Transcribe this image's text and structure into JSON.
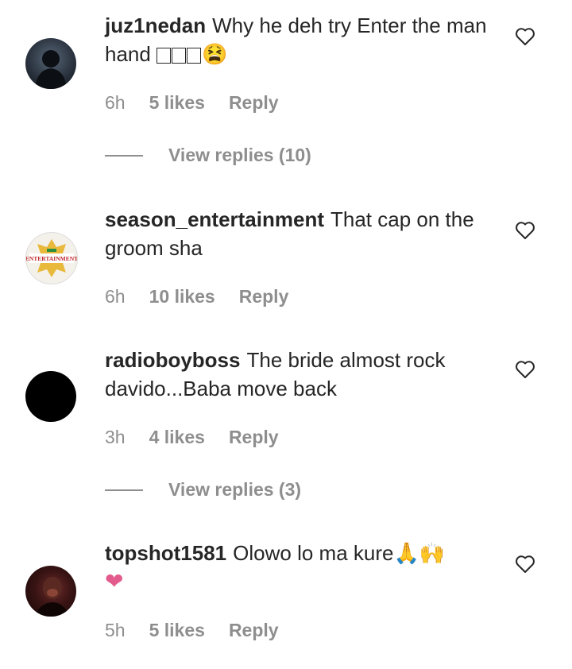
{
  "comments": [
    {
      "username": "juz1nedan",
      "text": "Why he deh try Enter the man hand",
      "emoji": "😫",
      "time": "6h",
      "likes": "5 likes",
      "reply": "Reply",
      "view_replies": "View replies (10)"
    },
    {
      "username": "season_entertainment",
      "text": "That cap on the groom sha",
      "time": "6h",
      "likes": "10 likes",
      "reply": "Reply",
      "avatar_text": "ENTERTAINMENT"
    },
    {
      "username": "radioboyboss",
      "text": "The bride almost rock davido...Baba move back",
      "time": "3h",
      "likes": "4 likes",
      "reply": "Reply",
      "view_replies": "View replies (3)"
    },
    {
      "username": "topshot1581",
      "text": "Olowo lo ma kure",
      "emoji": "🙏🙌",
      "emoji2": "❤",
      "time": "5h",
      "likes": "5 likes",
      "reply": "Reply"
    }
  ],
  "colors": {
    "text": "#262626",
    "meta": "#8e8e8e",
    "heart": "#e25b8c"
  },
  "icons": {
    "like": "heart-outline-icon"
  }
}
